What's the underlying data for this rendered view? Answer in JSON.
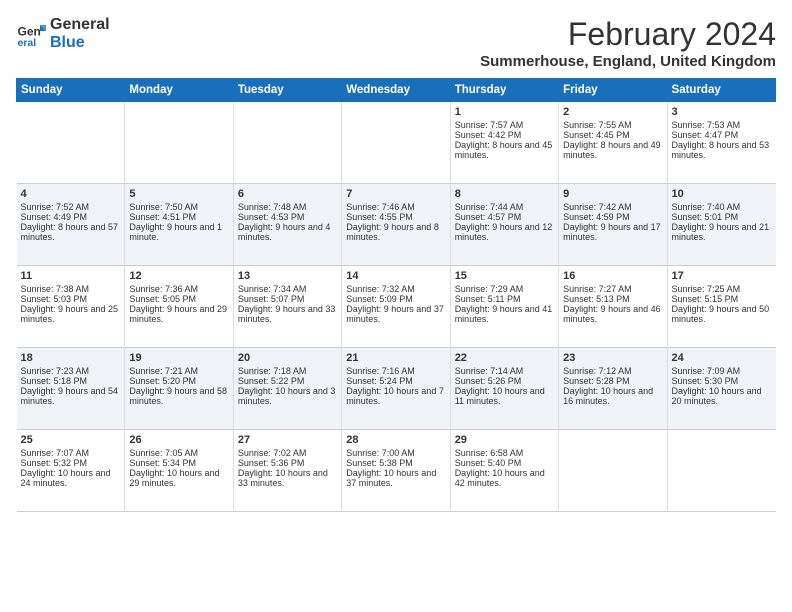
{
  "logo": {
    "line1": "General",
    "line2": "Blue"
  },
  "title": "February 2024",
  "subtitle": "Summerhouse, England, United Kingdom",
  "days_header": [
    "Sunday",
    "Monday",
    "Tuesday",
    "Wednesday",
    "Thursday",
    "Friday",
    "Saturday"
  ],
  "weeks": [
    [
      {
        "day": "",
        "sunrise": "",
        "sunset": "",
        "daylight": ""
      },
      {
        "day": "",
        "sunrise": "",
        "sunset": "",
        "daylight": ""
      },
      {
        "day": "",
        "sunrise": "",
        "sunset": "",
        "daylight": ""
      },
      {
        "day": "",
        "sunrise": "",
        "sunset": "",
        "daylight": ""
      },
      {
        "day": "1",
        "sunrise": "Sunrise: 7:57 AM",
        "sunset": "Sunset: 4:42 PM",
        "daylight": "Daylight: 8 hours and 45 minutes."
      },
      {
        "day": "2",
        "sunrise": "Sunrise: 7:55 AM",
        "sunset": "Sunset: 4:45 PM",
        "daylight": "Daylight: 8 hours and 49 minutes."
      },
      {
        "day": "3",
        "sunrise": "Sunrise: 7:53 AM",
        "sunset": "Sunset: 4:47 PM",
        "daylight": "Daylight: 8 hours and 53 minutes."
      }
    ],
    [
      {
        "day": "4",
        "sunrise": "Sunrise: 7:52 AM",
        "sunset": "Sunset: 4:49 PM",
        "daylight": "Daylight: 8 hours and 57 minutes."
      },
      {
        "day": "5",
        "sunrise": "Sunrise: 7:50 AM",
        "sunset": "Sunset: 4:51 PM",
        "daylight": "Daylight: 9 hours and 1 minute."
      },
      {
        "day": "6",
        "sunrise": "Sunrise: 7:48 AM",
        "sunset": "Sunset: 4:53 PM",
        "daylight": "Daylight: 9 hours and 4 minutes."
      },
      {
        "day": "7",
        "sunrise": "Sunrise: 7:46 AM",
        "sunset": "Sunset: 4:55 PM",
        "daylight": "Daylight: 9 hours and 8 minutes."
      },
      {
        "day": "8",
        "sunrise": "Sunrise: 7:44 AM",
        "sunset": "Sunset: 4:57 PM",
        "daylight": "Daylight: 9 hours and 12 minutes."
      },
      {
        "day": "9",
        "sunrise": "Sunrise: 7:42 AM",
        "sunset": "Sunset: 4:59 PM",
        "daylight": "Daylight: 9 hours and 17 minutes."
      },
      {
        "day": "10",
        "sunrise": "Sunrise: 7:40 AM",
        "sunset": "Sunset: 5:01 PM",
        "daylight": "Daylight: 9 hours and 21 minutes."
      }
    ],
    [
      {
        "day": "11",
        "sunrise": "Sunrise: 7:38 AM",
        "sunset": "Sunset: 5:03 PM",
        "daylight": "Daylight: 9 hours and 25 minutes."
      },
      {
        "day": "12",
        "sunrise": "Sunrise: 7:36 AM",
        "sunset": "Sunset: 5:05 PM",
        "daylight": "Daylight: 9 hours and 29 minutes."
      },
      {
        "day": "13",
        "sunrise": "Sunrise: 7:34 AM",
        "sunset": "Sunset: 5:07 PM",
        "daylight": "Daylight: 9 hours and 33 minutes."
      },
      {
        "day": "14",
        "sunrise": "Sunrise: 7:32 AM",
        "sunset": "Sunset: 5:09 PM",
        "daylight": "Daylight: 9 hours and 37 minutes."
      },
      {
        "day": "15",
        "sunrise": "Sunrise: 7:29 AM",
        "sunset": "Sunset: 5:11 PM",
        "daylight": "Daylight: 9 hours and 41 minutes."
      },
      {
        "day": "16",
        "sunrise": "Sunrise: 7:27 AM",
        "sunset": "Sunset: 5:13 PM",
        "daylight": "Daylight: 9 hours and 46 minutes."
      },
      {
        "day": "17",
        "sunrise": "Sunrise: 7:25 AM",
        "sunset": "Sunset: 5:15 PM",
        "daylight": "Daylight: 9 hours and 50 minutes."
      }
    ],
    [
      {
        "day": "18",
        "sunrise": "Sunrise: 7:23 AM",
        "sunset": "Sunset: 5:18 PM",
        "daylight": "Daylight: 9 hours and 54 minutes."
      },
      {
        "day": "19",
        "sunrise": "Sunrise: 7:21 AM",
        "sunset": "Sunset: 5:20 PM",
        "daylight": "Daylight: 9 hours and 58 minutes."
      },
      {
        "day": "20",
        "sunrise": "Sunrise: 7:18 AM",
        "sunset": "Sunset: 5:22 PM",
        "daylight": "Daylight: 10 hours and 3 minutes."
      },
      {
        "day": "21",
        "sunrise": "Sunrise: 7:16 AM",
        "sunset": "Sunset: 5:24 PM",
        "daylight": "Daylight: 10 hours and 7 minutes."
      },
      {
        "day": "22",
        "sunrise": "Sunrise: 7:14 AM",
        "sunset": "Sunset: 5:26 PM",
        "daylight": "Daylight: 10 hours and 11 minutes."
      },
      {
        "day": "23",
        "sunrise": "Sunrise: 7:12 AM",
        "sunset": "Sunset: 5:28 PM",
        "daylight": "Daylight: 10 hours and 16 minutes."
      },
      {
        "day": "24",
        "sunrise": "Sunrise: 7:09 AM",
        "sunset": "Sunset: 5:30 PM",
        "daylight": "Daylight: 10 hours and 20 minutes."
      }
    ],
    [
      {
        "day": "25",
        "sunrise": "Sunrise: 7:07 AM",
        "sunset": "Sunset: 5:32 PM",
        "daylight": "Daylight: 10 hours and 24 minutes."
      },
      {
        "day": "26",
        "sunrise": "Sunrise: 7:05 AM",
        "sunset": "Sunset: 5:34 PM",
        "daylight": "Daylight: 10 hours and 29 minutes."
      },
      {
        "day": "27",
        "sunrise": "Sunrise: 7:02 AM",
        "sunset": "Sunset: 5:36 PM",
        "daylight": "Daylight: 10 hours and 33 minutes."
      },
      {
        "day": "28",
        "sunrise": "Sunrise: 7:00 AM",
        "sunset": "Sunset: 5:38 PM",
        "daylight": "Daylight: 10 hours and 37 minutes."
      },
      {
        "day": "29",
        "sunrise": "Sunrise: 6:58 AM",
        "sunset": "Sunset: 5:40 PM",
        "daylight": "Daylight: 10 hours and 42 minutes."
      },
      {
        "day": "",
        "sunrise": "",
        "sunset": "",
        "daylight": ""
      },
      {
        "day": "",
        "sunrise": "",
        "sunset": "",
        "daylight": ""
      }
    ]
  ]
}
